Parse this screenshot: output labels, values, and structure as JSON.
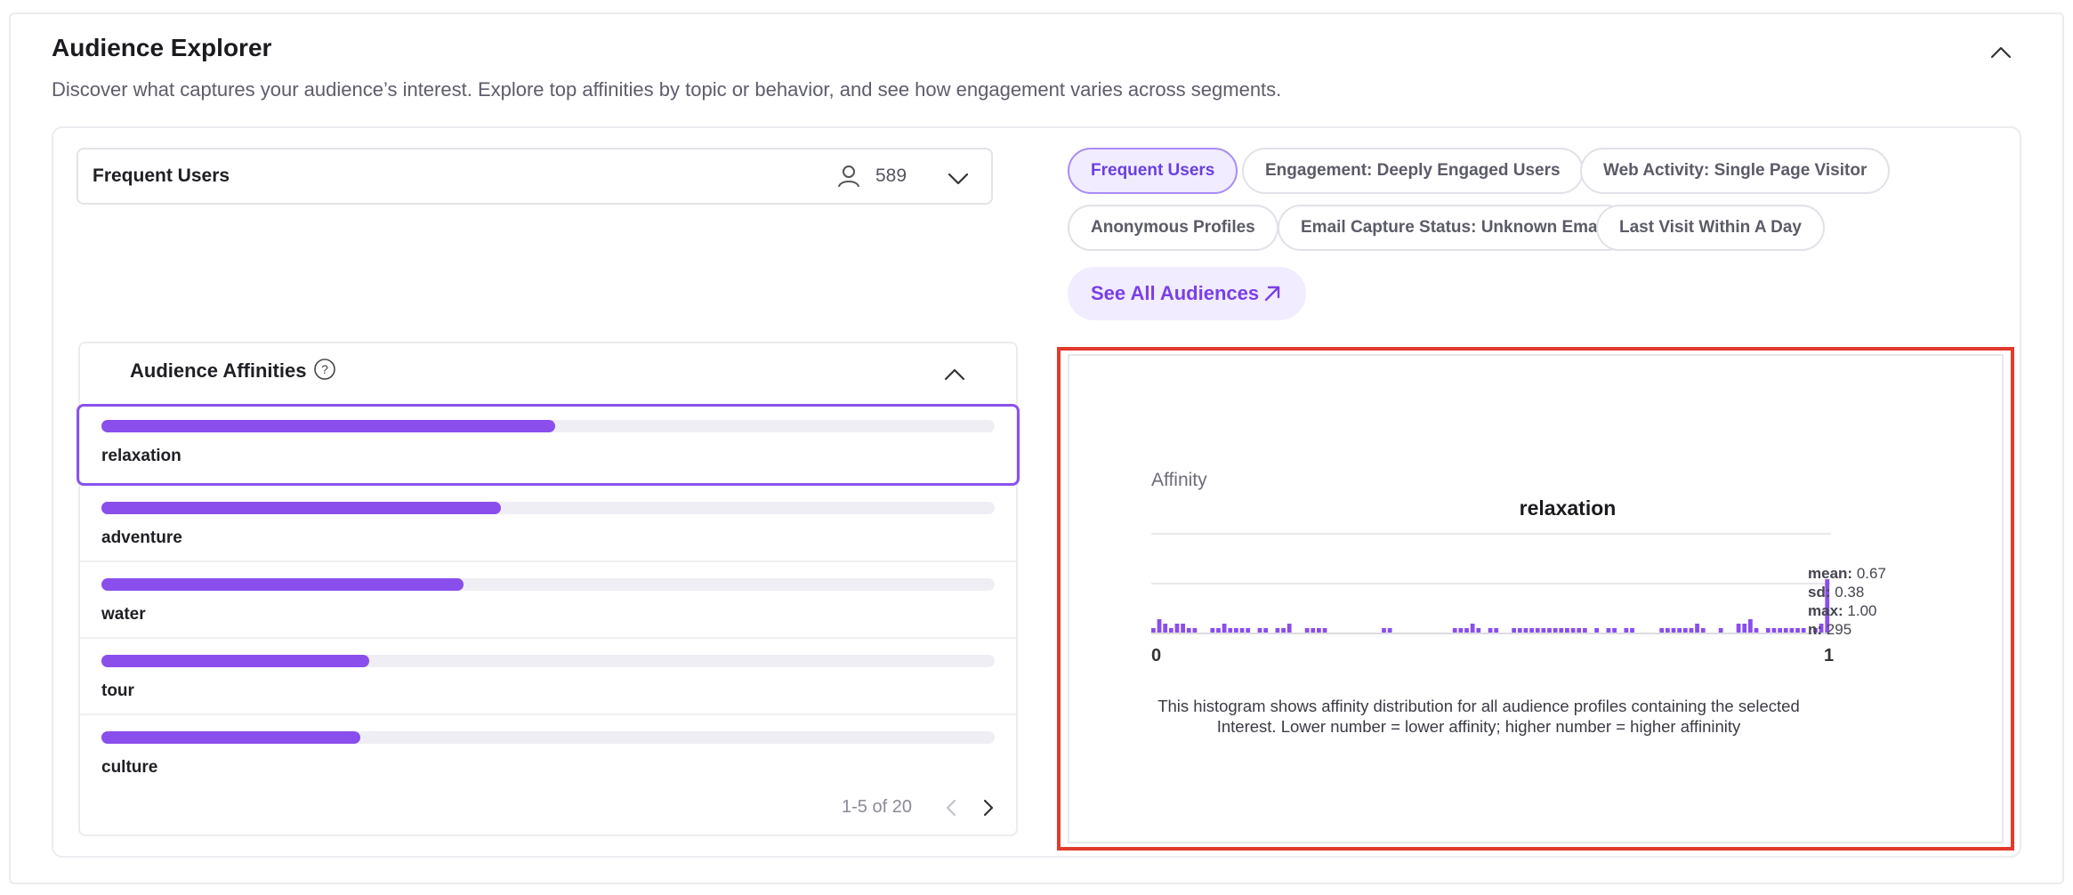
{
  "header": {
    "title": "Audience Explorer",
    "description": "Discover what captures your audience’s interest. Explore top affinities by topic or behavior, and see how engagement varies across segments."
  },
  "selector": {
    "audience": "Frequent Users",
    "count": "589"
  },
  "chips": [
    {
      "label": "Frequent Users",
      "active": true
    },
    {
      "label": "Engagement: Deeply Engaged Users",
      "active": false
    },
    {
      "label": "Web Activity: Single Page Visitor",
      "active": false
    },
    {
      "label": "Anonymous Profiles",
      "active": false
    },
    {
      "label": "Email Capture Status: Unknown Email",
      "active": false
    },
    {
      "label": "Last Visit Within A Day",
      "active": false
    }
  ],
  "see_all_label": "See All Audiences",
  "affinities": {
    "title": "Audience Affinities",
    "items": [
      {
        "label": "relaxation",
        "value": 0.508
      },
      {
        "label": "adventure",
        "value": 0.447
      },
      {
        "label": "water",
        "value": 0.405
      },
      {
        "label": "tour",
        "value": 0.3
      },
      {
        "label": "culture",
        "value": 0.29
      }
    ],
    "pager": "1-5 of 20"
  },
  "histogram": {
    "ylabel": "Affinity",
    "title": "relaxation",
    "x_min_label": "0",
    "x_max_label": "1",
    "stats": {
      "mean_label": "mean:",
      "mean": "0.67",
      "sd_label": "sd:",
      "sd": "0.38",
      "max_label": "max:",
      "max": "1.00",
      "n_label": "n:",
      "n": "295"
    },
    "note": "This histogram shows affinity distribution for all audience profiles containing the selected Interest. Lower number = lower affinity; higher number = higher affininity"
  },
  "colors": {
    "accent": "#8a4eec",
    "highlight_border": "#e23a2c"
  },
  "chart_data": {
    "type": "bar",
    "title": "relaxation",
    "ylabel": "Affinity",
    "xlim": [
      0,
      1
    ],
    "bins": 100,
    "values": [
      1,
      3,
      2,
      1,
      2,
      2,
      1,
      1,
      0,
      0,
      1,
      1,
      2,
      1,
      1,
      1,
      1,
      0,
      1,
      1,
      0,
      1,
      1,
      2,
      0,
      0,
      1,
      1,
      1,
      1,
      0,
      0,
      0,
      0,
      0,
      0,
      0,
      0,
      0,
      1,
      1,
      0,
      0,
      0,
      0,
      0,
      0,
      0,
      0,
      0,
      0,
      1,
      1,
      1,
      2,
      1,
      0,
      1,
      1,
      0,
      0,
      1,
      1,
      1,
      1,
      1,
      1,
      1,
      1,
      1,
      1,
      1,
      1,
      1,
      0,
      1,
      0,
      1,
      1,
      0,
      1,
      1,
      0,
      0,
      0,
      0,
      1,
      1,
      1,
      1,
      1,
      1,
      2,
      1,
      0,
      0,
      1,
      0,
      0,
      2,
      2,
      3,
      1,
      0,
      1,
      1,
      1,
      1,
      1,
      1,
      1,
      0,
      1,
      2,
      12
    ]
  }
}
